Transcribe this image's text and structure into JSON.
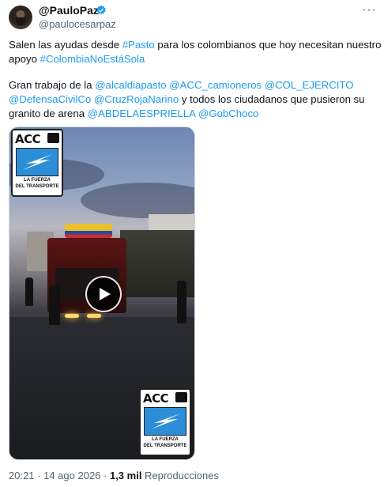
{
  "author": {
    "display_name": "@PauloPaz",
    "handle": "@paulocesarpaz",
    "verified_icon": "verified-badge-icon",
    "more_icon": "more-options-icon"
  },
  "tweet": {
    "lines": [
      [
        {
          "t": "Salen las ayudas desde ",
          "link": false
        },
        {
          "t": "#Pasto",
          "link": true
        },
        {
          "t": " para los colombianos que hoy necesitan nuestro",
          "link": false
        }
      ],
      [
        {
          "t": "apoyo ",
          "link": false
        },
        {
          "t": "#ColombiaNoEstáSola",
          "link": true
        }
      ],
      [],
      [
        {
          "t": "Gran trabajo de la ",
          "link": false
        },
        {
          "t": "@alcaldiapasto",
          "link": true
        },
        {
          "t": " ",
          "link": false
        },
        {
          "t": "@ACC_camioneros",
          "link": true
        },
        {
          "t": " ",
          "link": false
        },
        {
          "t": "@COL_EJERCITO",
          "link": true
        }
      ],
      [
        {
          "t": "@DefensaCivilCo",
          "link": true
        },
        {
          "t": " ",
          "link": false
        },
        {
          "t": "@CruzRojaNarino",
          "link": true
        },
        {
          "t": " y todos los ciudadanos que pusieron su",
          "link": false
        }
      ],
      [
        {
          "t": "granito de arena ",
          "link": false
        },
        {
          "t": "@ABDELAESPRIELLA",
          "link": true
        },
        {
          "t": " ",
          "link": false
        },
        {
          "t": "@GobChoco",
          "link": true
        }
      ]
    ]
  },
  "video": {
    "logo_top": {
      "brand": "ACC",
      "tagline_1": "LA FUERZA",
      "tagline_2": "DEL TRANSPORTE"
    },
    "logo_bottom": {
      "brand": "ACC",
      "tagline_1": "LA FUERZA",
      "tagline_2": "DEL TRANSPORTE"
    },
    "play_icon": "play-icon"
  },
  "meta": {
    "time": "20:21",
    "separator": " · ",
    "date": "14 ago 2026",
    "views_count": "1,3 mil",
    "views_label": " Reproducciones"
  },
  "colors": {
    "link": "#1d9bf0",
    "text": "#0f1419",
    "muted": "#536471",
    "verified": "#1d9bf0"
  }
}
